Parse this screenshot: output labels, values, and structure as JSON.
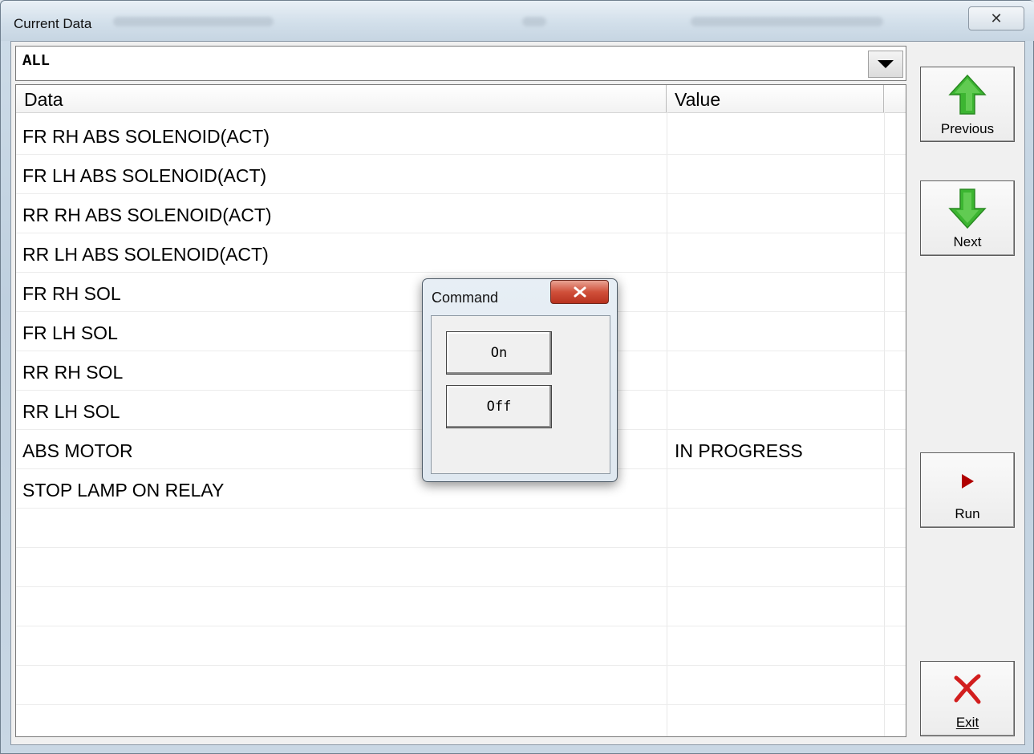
{
  "window": {
    "title": "Current Data"
  },
  "filter": {
    "selected": "ALL"
  },
  "table": {
    "columns": [
      "Data",
      "Value"
    ],
    "rows": [
      {
        "data": "FR RH ABS SOLENOID(ACT)",
        "value": ""
      },
      {
        "data": "FR LH ABS SOLENOID(ACT)",
        "value": ""
      },
      {
        "data": "RR RH ABS SOLENOID(ACT)",
        "value": ""
      },
      {
        "data": "RR LH ABS SOLENOID(ACT)",
        "value": ""
      },
      {
        "data": "FR RH SOL",
        "value": ""
      },
      {
        "data": "FR LH SOL",
        "value": ""
      },
      {
        "data": "RR RH SOL",
        "value": ""
      },
      {
        "data": "RR LH SOL",
        "value": ""
      },
      {
        "data": "ABS MOTOR",
        "value": "IN PROGRESS"
      },
      {
        "data": "STOP LAMP ON RELAY",
        "value": ""
      }
    ]
  },
  "side_buttons": {
    "previous": "Previous",
    "next": "Next",
    "run": "Run",
    "exit": "Exit"
  },
  "dialog": {
    "title": "Command",
    "on_label": "On",
    "off_label": "Off"
  },
  "colors": {
    "arrow_green": "#3cb531",
    "run_red": "#b00000",
    "exit_red": "#d21e1e"
  }
}
